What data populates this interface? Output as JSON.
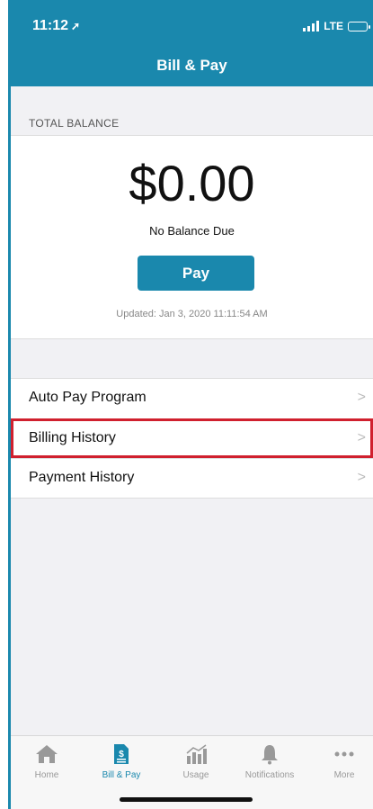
{
  "status": {
    "time": "11:12",
    "network": "LTE"
  },
  "header": {
    "title": "Bill & Pay"
  },
  "balance": {
    "section_label": "TOTAL BALANCE",
    "amount": "$0.00",
    "due_text": "No Balance Due",
    "pay_label": "Pay",
    "updated": "Updated: Jan 3, 2020 11:11:54 AM"
  },
  "menu": {
    "items": [
      {
        "label": "Auto Pay Program"
      },
      {
        "label": "Billing History"
      },
      {
        "label": "Payment History"
      }
    ]
  },
  "tabs": [
    {
      "label": "Home",
      "icon": "home-icon"
    },
    {
      "label": "Bill & Pay",
      "icon": "bill-icon"
    },
    {
      "label": "Usage",
      "icon": "usage-icon"
    },
    {
      "label": "Notifications",
      "icon": "bell-icon"
    },
    {
      "label": "More",
      "icon": "more-icon"
    }
  ],
  "colors": {
    "brand": "#1a88ad",
    "highlight": "#d0202e",
    "background": "#f1f1f4"
  }
}
